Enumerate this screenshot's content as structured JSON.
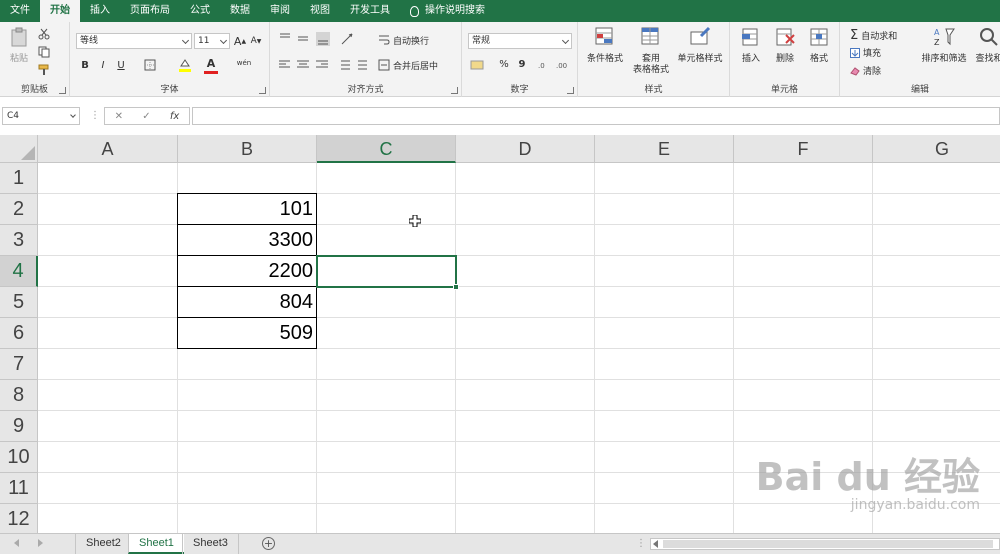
{
  "menu": {
    "tabs": [
      "文件",
      "开始",
      "插入",
      "页面布局",
      "公式",
      "数据",
      "审阅",
      "视图",
      "开发工具"
    ],
    "active_index": 1,
    "search_label": "操作说明搜索"
  },
  "ribbon": {
    "clipboard": {
      "label": "剪贴板",
      "paste": "粘贴"
    },
    "font": {
      "label": "字体",
      "name": "等线",
      "size": "11",
      "bold": "B",
      "italic": "I",
      "underline": "U",
      "grow": "A",
      "shrink": "A",
      "color_label": "A",
      "wen": "wén"
    },
    "align": {
      "label": "对齐方式",
      "wrap": "自动换行",
      "merge": "合并后居中"
    },
    "number": {
      "label": "数字",
      "format": "常规",
      "percent": "%",
      "comma": "9"
    },
    "styles": {
      "label": "样式",
      "conditional": "条件格式",
      "table_format_1": "套用",
      "table_format_2": "表格格式",
      "cell_styles": "单元格样式"
    },
    "cells": {
      "label": "单元格",
      "insert": "插入",
      "delete": "删除",
      "format": "格式"
    },
    "editing": {
      "label": "编辑",
      "autosum": "自动求和",
      "fill": "填充",
      "clear": "清除",
      "sort": "排序和筛选",
      "find": "查找和"
    }
  },
  "formula_bar": {
    "name_box": "C4",
    "cancel": "✕",
    "enter": "✓",
    "fx": "fx",
    "value": ""
  },
  "grid": {
    "columns": [
      "A",
      "B",
      "C",
      "D",
      "E",
      "F",
      "G"
    ],
    "rows": [
      "1",
      "2",
      "3",
      "4",
      "5",
      "6",
      "7",
      "8",
      "9",
      "10",
      "11",
      "12"
    ],
    "selected_cell": "C4",
    "cells": [
      {
        "ref": "B2",
        "value": "101"
      },
      {
        "ref": "B3",
        "value": "3300"
      },
      {
        "ref": "B4",
        "value": "2200"
      },
      {
        "ref": "B5",
        "value": "804"
      },
      {
        "ref": "B6",
        "value": "509"
      }
    ]
  },
  "sheets": {
    "tabs": [
      "Sheet2",
      "Sheet1",
      "Sheet3"
    ],
    "active_index": 1,
    "add": "+"
  },
  "watermark": {
    "line1": "Bai du 经验",
    "line2": "jingyan.baidu.com"
  }
}
